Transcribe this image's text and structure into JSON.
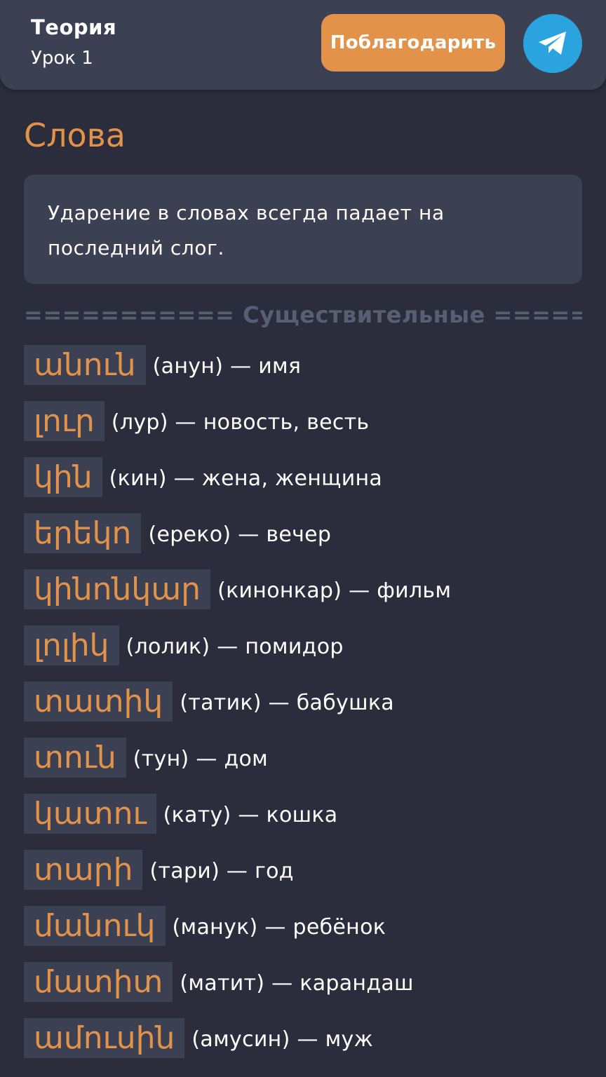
{
  "header": {
    "title": "Теория",
    "subtitle": "Урок 1",
    "thank_button": "Поблагодарить",
    "telegram_icon": "telegram-icon"
  },
  "colors": {
    "accent": "#e3924a",
    "background": "#2b2d3d",
    "card": "#3c4053",
    "telegram": "#2aa3df"
  },
  "section": {
    "title": "Слова",
    "note": "Ударение в словах всегда падает на последний слог."
  },
  "divider": "=========== Существительные ==========",
  "words": [
    {
      "armenian": "անուն",
      "translit": "(анун) — имя"
    },
    {
      "armenian": "լուր",
      "translit": "(лур) — новость, весть"
    },
    {
      "armenian": "կին",
      "translit": "(кин) — жена, женщина"
    },
    {
      "armenian": "երեկո",
      "translit": "(ереко) — вечер"
    },
    {
      "armenian": "կինոնկար",
      "translit": "(кинонкар) — фильм"
    },
    {
      "armenian": "լոլիկ",
      "translit": "(лолик) — помидор"
    },
    {
      "armenian": "տատիկ",
      "translit": "(татик) — бабушка"
    },
    {
      "armenian": "տուն",
      "translit": "(тун) — дом"
    },
    {
      "armenian": "կատու",
      "translit": "(кату) — кошка"
    },
    {
      "armenian": "տարի",
      "translit": "(тари) — год"
    },
    {
      "armenian": "մանուկ",
      "translit": "(манук) — ребёнок"
    },
    {
      "armenian": "մատիտ",
      "translit": "(матит) — карандаш"
    },
    {
      "armenian": "ամուսին",
      "translit": "(амусин) — муж"
    }
  ]
}
